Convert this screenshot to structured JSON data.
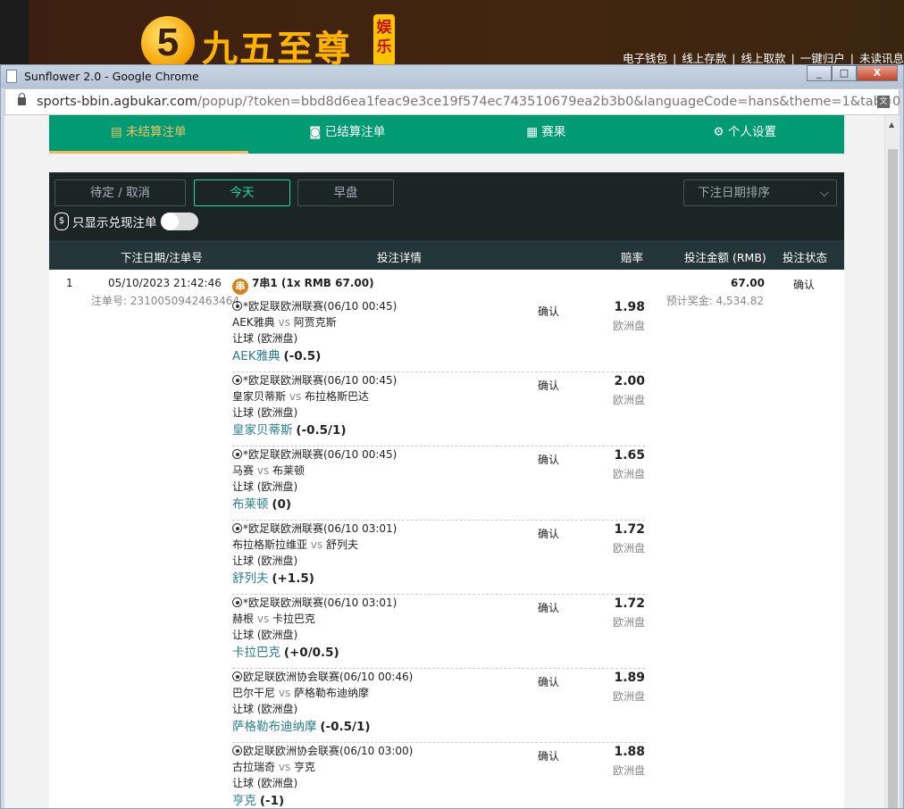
{
  "site": {
    "logo_number": "5",
    "logo_text": "九五至尊",
    "logo_tag": "娱乐",
    "top_links": [
      "电子钱包",
      "线上存款",
      "线上取款",
      "一键归户",
      "未读讯息"
    ]
  },
  "window": {
    "title": "Sunflower 2.0 - Google Chrome",
    "minimize": "_",
    "maximize": "□",
    "close": "X"
  },
  "address": {
    "domain": "sports-bbin.agbukar.com",
    "path": "/popup/?token=bbd8d6ea1feac9e3ce19f574ec743510679ea2b3b0&languageCode=hans&theme=1&tab=0"
  },
  "tabs": [
    {
      "label": "未结算注单",
      "icon": "receipt-icon"
    },
    {
      "label": "已结算注单",
      "icon": "settled-icon"
    },
    {
      "label": "赛果",
      "icon": "scoreboard-icon"
    },
    {
      "label": "个人设置",
      "icon": "gear-icon"
    }
  ],
  "filters": {
    "pending": "待定 / 取消",
    "today": "今天",
    "early": "早盘",
    "sort": "下注日期排序",
    "cashout_only": "只显示兑现注单"
  },
  "columns": {
    "date": "下注日期/注单号",
    "details": "投注详情",
    "odds": "赔率",
    "amount": "投注金额 (RMB)",
    "status": "投注状态"
  },
  "bet": {
    "index": "1",
    "datetime": "05/10/2023 21:42:46",
    "order_label": "注单号: 2310050942463464",
    "type_badge": "串",
    "type": "7串1 (1x RMB 67.00)",
    "amount": "67.00",
    "est_payout": "预计奖金: 4,534.82",
    "status": "确认",
    "legs": [
      {
        "league": "*欧足联欧洲联赛(06/10 00:45)",
        "home": "AEK雅典",
        "away": "阿贾克斯",
        "market": "让球 (欧洲盘)",
        "selection": "AEK雅典",
        "handicap": "(-0.5)",
        "status": "确认",
        "odds": "1.98",
        "odds_type": "欧洲盘"
      },
      {
        "league": "*欧足联欧洲联赛(06/10 00:45)",
        "home": "皇家贝蒂斯",
        "away": "布拉格斯巴达",
        "market": "让球 (欧洲盘)",
        "selection": "皇家贝蒂斯",
        "handicap": "(-0.5/1)",
        "status": "确认",
        "odds": "2.00",
        "odds_type": "欧洲盘"
      },
      {
        "league": "*欧足联欧洲联赛(06/10 00:45)",
        "home": "马赛",
        "away": "布莱顿",
        "market": "让球 (欧洲盘)",
        "selection": "布莱顿",
        "handicap": "(0)",
        "status": "确认",
        "odds": "1.65",
        "odds_type": "欧洲盘"
      },
      {
        "league": "*欧足联欧洲联赛(06/10 03:01)",
        "home": "布拉格斯拉维亚",
        "away": "舒列夫",
        "market": "让球 (欧洲盘)",
        "selection": "舒列夫",
        "handicap": "(+1.5)",
        "status": "确认",
        "odds": "1.72",
        "odds_type": "欧洲盘"
      },
      {
        "league": "*欧足联欧洲联赛(06/10 03:01)",
        "home": "赫根",
        "away": "卡拉巴克",
        "market": "让球 (欧洲盘)",
        "selection": "卡拉巴克",
        "handicap": "(+0/0.5)",
        "status": "确认",
        "odds": "1.72",
        "odds_type": "欧洲盘"
      },
      {
        "league": "欧足联欧洲协会联赛(06/10 00:46)",
        "home": "巴尔干尼",
        "away": "萨格勒布迪纳摩",
        "market": "让球 (欧洲盘)",
        "selection": "萨格勒布迪纳摩",
        "handicap": "(-0.5/1)",
        "status": "确认",
        "odds": "1.89",
        "odds_type": "欧洲盘"
      },
      {
        "league": "欧足联欧洲协会联赛(06/10 03:00)",
        "home": "古拉瑞奇",
        "away": "亨克",
        "market": "让球 (欧洲盘)",
        "selection": "亨克",
        "handicap": "(-1)",
        "status": "确认",
        "odds": "1.88",
        "odds_type": "欧洲盘"
      }
    ]
  },
  "vs": "vs"
}
